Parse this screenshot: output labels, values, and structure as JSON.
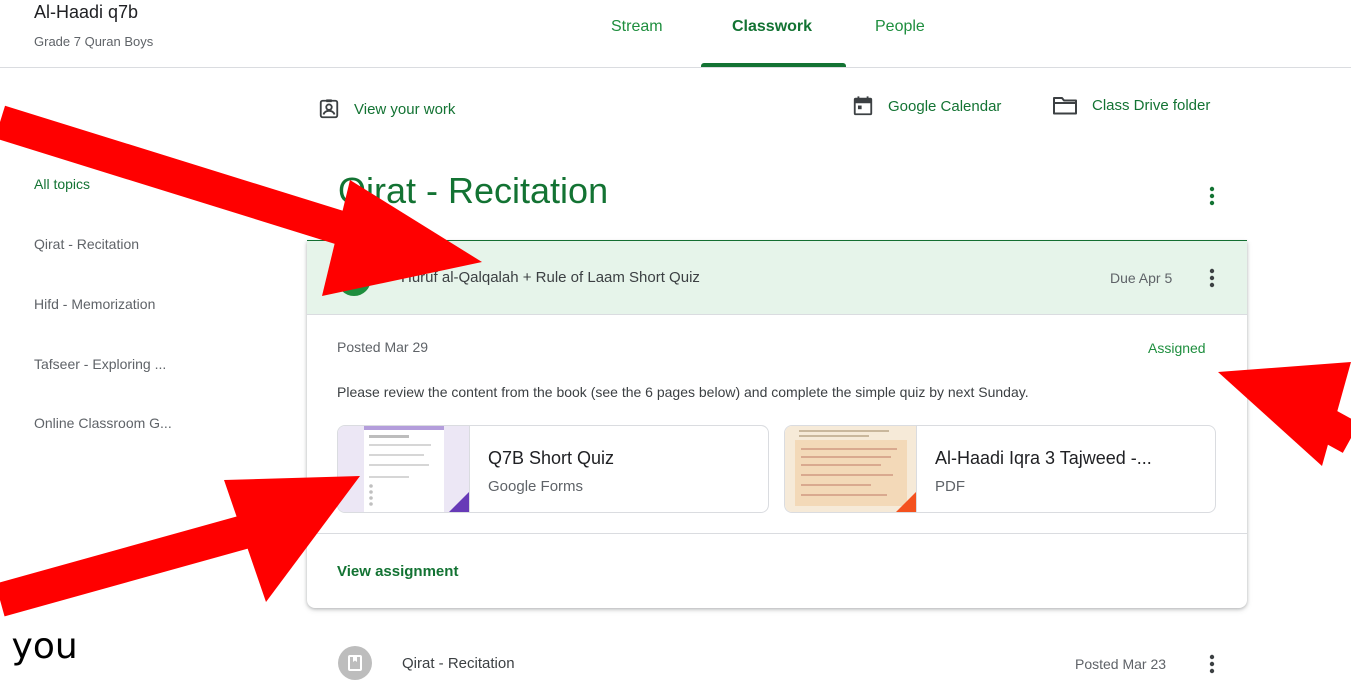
{
  "header": {
    "class_title": "Al-Haadi q7b",
    "class_subtitle": "Grade 7 Quran Boys",
    "tabs": [
      {
        "label": "Stream"
      },
      {
        "label": "Classwork"
      },
      {
        "label": "People"
      }
    ]
  },
  "sidebar": {
    "items": [
      {
        "label": "All topics"
      },
      {
        "label": "Qirat - Recitation"
      },
      {
        "label": "Hifd - Memorization"
      },
      {
        "label": "Tafseer - Exploring ..."
      },
      {
        "label": "Online Classroom G..."
      }
    ]
  },
  "toolbar": {
    "view_work": "View your work",
    "calendar": "Google Calendar",
    "drive": "Class Drive folder"
  },
  "topic": {
    "title": "Qirat - Recitation"
  },
  "assignment": {
    "title": "Huruf al-Qalqalah + Rule of Laam Short Quiz",
    "due": "Due Apr 5",
    "posted": "Posted Mar 29",
    "status": "Assigned",
    "description": "Please review the content from the book (see the 6 pages below) and complete the simple quiz by next Sunday.",
    "attachments": [
      {
        "title": "Q7B Short Quiz",
        "type": "Google Forms"
      },
      {
        "title": "Al-Haadi Iqra 3 Tajweed -...",
        "type": "PDF"
      }
    ],
    "view_label": "View assignment"
  },
  "next_item": {
    "title": "Qirat - Recitation",
    "date": "Posted Mar 23"
  },
  "overlay": {
    "text": "t you"
  },
  "colors": {
    "accent": "#137333",
    "accent_light": "#e6f4ea",
    "annotation_arrow": "#ff0000",
    "forms_corner": "#673ab7",
    "pdf_corner": "#f4511e"
  },
  "icons": [
    "portrait-icon",
    "calendar-icon",
    "folder-icon",
    "more-vert-icon",
    "assignment-icon",
    "material-icon"
  ]
}
